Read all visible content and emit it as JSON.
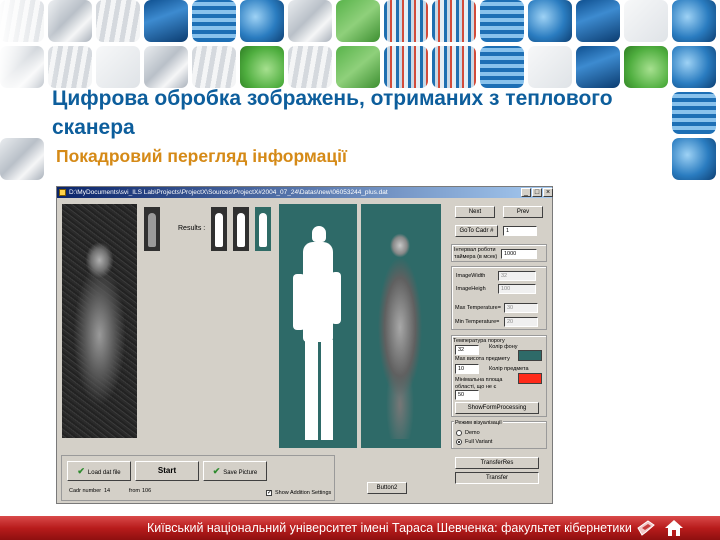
{
  "slide": {
    "title": "Цифрова обробка зображень, отриманих з теплового сканера",
    "subtitle": "Покадровий перегляд інформації",
    "footer_text": "Київський національний університет імені Тараса Шевченка: факультет кібернетики"
  },
  "app_window": {
    "title_path": "D:\\MyDocuments\\svi_ILS Lab\\Projects\\ProjectX\\Sources\\ProjectX#2004_07_24\\Datas\\new\\06053244_plus.dat",
    "results_label": "Results :",
    "buttons": {
      "next": "Next",
      "prev": "Prev",
      "goto_cadr": "GoTo Cadr #",
      "show_form_processing": "ShowFormProcessing",
      "transfer_res": "TransferRes",
      "transfer": "Transfer",
      "load_dat_file": "Load dat file",
      "start": "Start",
      "save_picture": "Save Picture",
      "button2": "Button2"
    },
    "fields": {
      "goto_cadr_value": "1",
      "timer_interval_label": "Інтервал роботи таймера (в мсек)",
      "timer_interval_value": "1000",
      "image_width_label": "ImageWidth",
      "image_width_value": "32",
      "image_height_label": "ImageHeigh",
      "image_height_value": "100",
      "max_temp_label": "Max Temperature=",
      "max_temp_value": "30",
      "min_temp_label": "Min Temperature=",
      "min_temp_value": "20",
      "threshold_label": "Температура порогу",
      "threshold_value": "32",
      "bg_color_label": "Колір фону",
      "max_height_label": "Мax висота предмету",
      "max_height_value": "10",
      "obj_color_label": "Колір предмета",
      "min_area_label": "Мінімальна площа області, що не є фоном",
      "min_area_value": "50"
    },
    "visualization": {
      "group_label": "Режим візуалізації",
      "options": [
        "Demo",
        "Full Variant"
      ],
      "selected": "Full Variant"
    },
    "status": {
      "cadr_number_label": "Cadr number",
      "cadr_number_value": "14",
      "from_label": "from",
      "from_value": "106"
    },
    "show_addition_settings": {
      "label": "Show Addition Settings",
      "checked": true
    },
    "colors": {
      "background_swatch": "#2e6a68",
      "object_swatch": "#ff2a1a"
    }
  },
  "footer_icons": [
    "back-arrow-icon",
    "home-icon"
  ]
}
